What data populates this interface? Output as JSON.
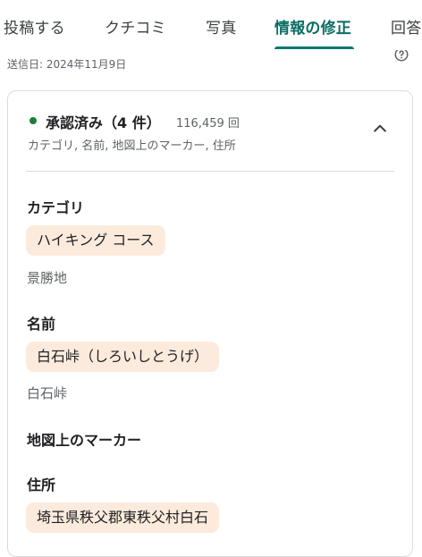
{
  "tabs": [
    {
      "label": "投稿する",
      "active": false
    },
    {
      "label": "クチコミ",
      "active": false
    },
    {
      "label": "写真",
      "active": false
    },
    {
      "label": "情報の修正",
      "active": true
    },
    {
      "label": "回答",
      "active": false
    }
  ],
  "colors": {
    "accent": "#0b7a6e",
    "approved": "#188038",
    "chip_background": "#fcebdc"
  },
  "header": {
    "sent_date": "送信日: 2024年11月9日",
    "help_icon": "help-circle-icon"
  },
  "edit": {
    "status": "承認済み（4 件）",
    "views": "116,459 回",
    "summary": "カテゴリ, 名前, 地図上のマーカー, 住所",
    "collapse_icon": "chevron-up-icon",
    "fields": [
      {
        "label": "カテゴリ",
        "new_value": "ハイキング コース",
        "old_value": "景勝地"
      },
      {
        "label": "名前",
        "new_value": "白石峠（しろいしとうげ）",
        "old_value": "白石峠"
      },
      {
        "label": "地図上のマーカー"
      },
      {
        "label": "住所",
        "new_value": "埼玉県秩父郡東秩父村白石"
      }
    ]
  }
}
